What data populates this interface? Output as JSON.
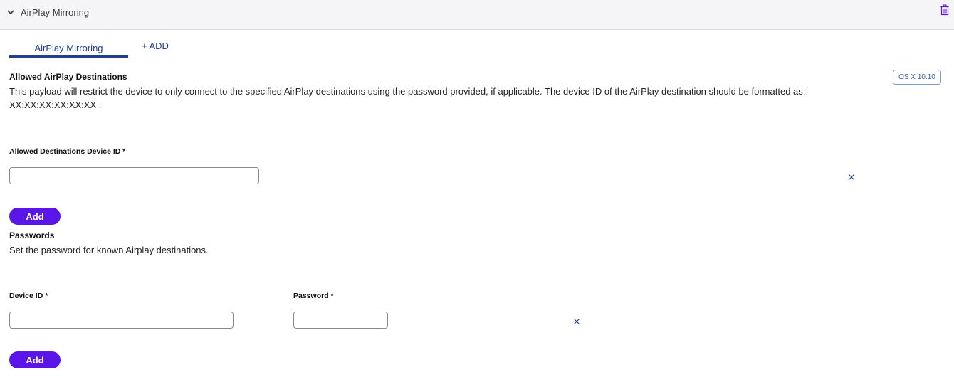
{
  "section": {
    "title": "AirPlay Mirroring",
    "icons": {
      "collapse": "chevron-down-icon",
      "delete": "trash-icon"
    }
  },
  "tabs": [
    {
      "label": "AirPlay Mirroring",
      "active": true
    },
    {
      "label": "+ ADD",
      "active": false
    }
  ],
  "allowed": {
    "heading": "Allowed AirPlay Destinations",
    "os_badge": "OS X 10.10",
    "description": "This payload will restrict the device to only connect to the specified AirPlay destinations using the password provided, if applicable. The device ID of the AirPlay destination should be formatted as:",
    "format": "XX:XX:XX:XX:XX:XX .",
    "device_id_label": "Allowed Destinations Device ID *",
    "device_id_value": "",
    "add_label": "Add"
  },
  "passwords": {
    "heading": "Passwords",
    "description": "Set the password for known Airplay destinations.",
    "device_id_label": "Device ID *",
    "password_label": "Password *",
    "device_id_value": "",
    "password_value": "",
    "add_label": "Add"
  },
  "colors": {
    "accent": "#5a16e8",
    "tab_text": "#1f3f8f",
    "header_bg": "#f5f5f8",
    "badge_border": "#7a9cc7"
  }
}
